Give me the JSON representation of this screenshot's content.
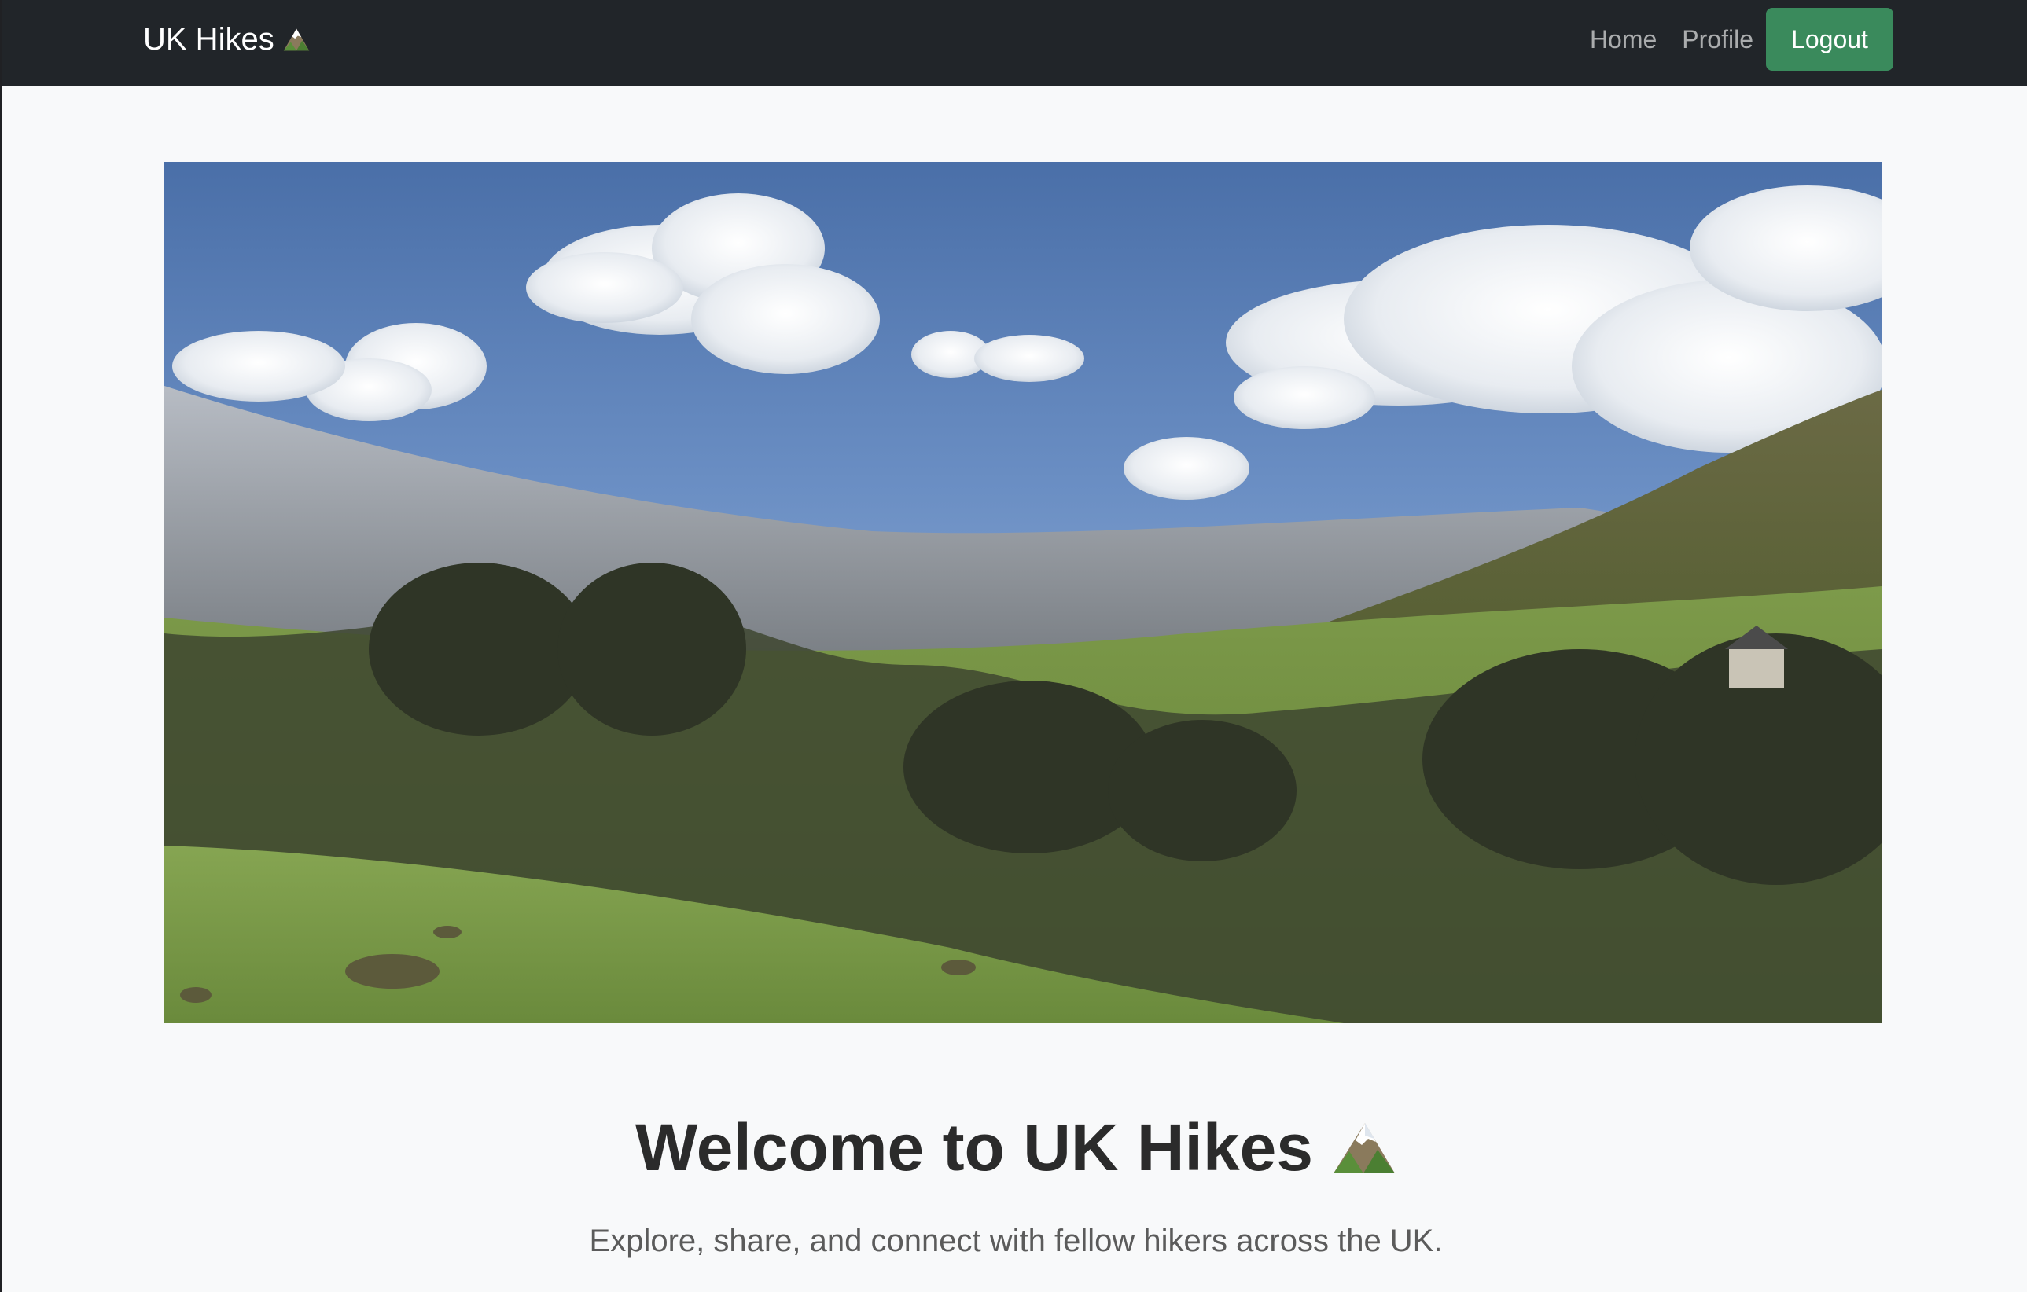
{
  "navbar": {
    "brand": "UK Hikes",
    "brand_icon": "mountain-icon",
    "links": {
      "home": "Home",
      "profile": "Profile"
    },
    "logout_label": "Logout",
    "colors": {
      "background": "#212529",
      "logout_button": "#3a8a5c"
    }
  },
  "hero": {
    "image": "valley-landscape-photo"
  },
  "welcome": {
    "title": "Welcome to UK Hikes",
    "title_icon": "mountain-icon",
    "subtitle": "Explore, share, and connect with fellow hikers across the UK."
  }
}
